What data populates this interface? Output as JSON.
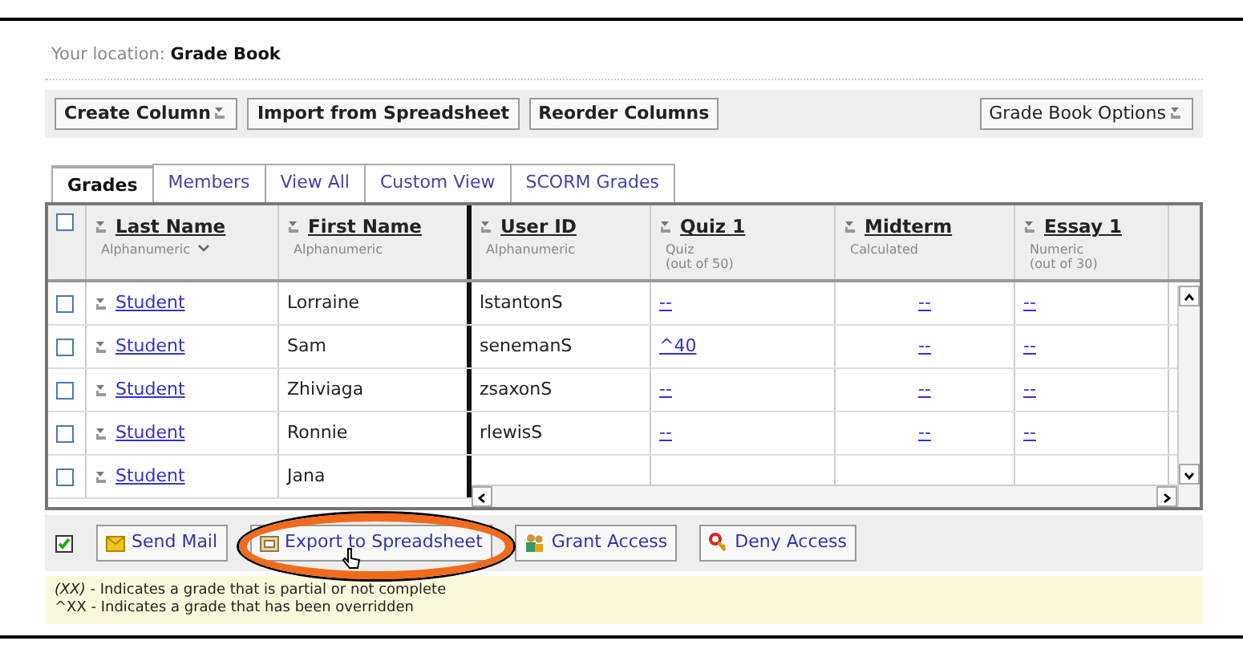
{
  "location": {
    "label": "Your location:",
    "value": "Grade Book"
  },
  "toolbar": {
    "buttons": [
      {
        "label": "Create Column",
        "dropdown": true
      },
      {
        "label": "Import from Spreadsheet",
        "dropdown": false
      },
      {
        "label": "Reorder Columns",
        "dropdown": false
      }
    ],
    "options": {
      "label": "Grade Book Options",
      "dropdown": true
    }
  },
  "tabs": [
    {
      "label": "Grades",
      "selected": true
    },
    {
      "label": "Members",
      "selected": false
    },
    {
      "label": "View All",
      "selected": false
    },
    {
      "label": "Custom View",
      "selected": false
    },
    {
      "label": "SCORM Grades",
      "selected": false
    }
  ],
  "table": {
    "select_all": {
      "checked": false
    },
    "columns": [
      {
        "label": "Last Name",
        "sub": [
          "Alphanumeric"
        ],
        "sorted": true
      },
      {
        "label": "First Name",
        "sub": [
          "Alphanumeric"
        ],
        "sorted": false
      },
      {
        "label": "User ID",
        "sub": [
          "Alphanumeric"
        ],
        "sorted": false
      },
      {
        "label": "Quiz 1",
        "sub": [
          "Quiz",
          "(out of 50)"
        ],
        "sorted": false
      },
      {
        "label": "Midterm",
        "sub": [
          "Calculated"
        ],
        "sorted": false
      },
      {
        "label": "Essay 1",
        "sub": [
          "Numeric",
          "(out of 30)"
        ],
        "sorted": false
      }
    ],
    "rows": [
      {
        "checked": false,
        "last_name": "Student",
        "first_name": "Lorraine",
        "user_id": "lstantonS",
        "grades": [
          "--",
          "--",
          "--"
        ]
      },
      {
        "checked": false,
        "last_name": "Student",
        "first_name": "Sam",
        "user_id": "senemanS",
        "grades": [
          "^40",
          "--",
          "--"
        ]
      },
      {
        "checked": false,
        "last_name": "Student",
        "first_name": "Zhiviaga",
        "user_id": "zsaxonS",
        "grades": [
          "--",
          "--",
          "--"
        ]
      },
      {
        "checked": false,
        "last_name": "Student",
        "first_name": "Ronnie",
        "user_id": "rlewisS",
        "grades": [
          "--",
          "--",
          "--"
        ]
      },
      {
        "checked": false,
        "last_name": "Student",
        "first_name": "Jana",
        "grades": []
      }
    ]
  },
  "actions": [
    {
      "kind": "mail",
      "label": "Send Mail",
      "highlighted": false
    },
    {
      "kind": "export",
      "label": "Export to Spreadsheet",
      "highlighted": true
    },
    {
      "kind": "grant",
      "label": "Grant Access",
      "highlighted": false
    },
    {
      "kind": "deny",
      "label": "Deny Access",
      "highlighted": false
    }
  ],
  "legend": [
    "*(XX)* - Indicates a grade that is partial or not complete",
    "^XX - Indicates a grade that has been overridden"
  ]
}
